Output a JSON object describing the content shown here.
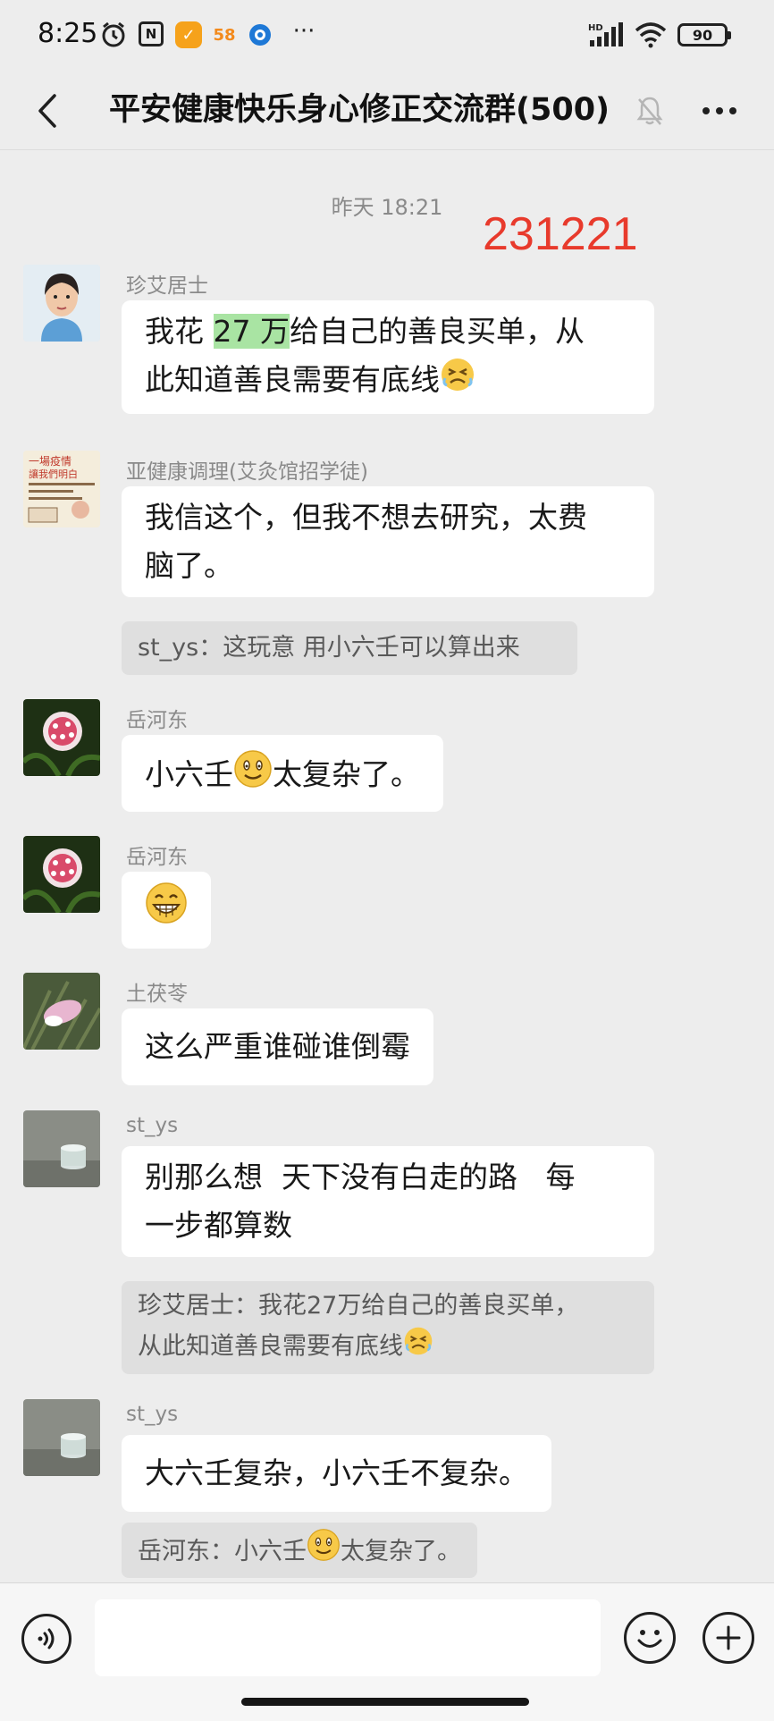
{
  "status_bar": {
    "time": "8:25",
    "app_icon_58": "58",
    "more": "···",
    "network": "HD",
    "battery": "90"
  },
  "header": {
    "title": "平安健康快乐身心修正交流群(500)",
    "muted": true
  },
  "chat": {
    "timestamp": "昨天 18:21",
    "overlay_code": "231221",
    "messages": [
      {
        "sender": "珍艾居士",
        "parts": [
          "我花 ",
          "27 万",
          "给自己的善良买单，从",
          "此知道善良需要有底线"
        ],
        "emoji": "persevering-face"
      },
      {
        "sender": "亚健康调理(艾灸馆招学徒)",
        "lines": [
          "我信这个，但我不想去研究，太费",
          "脑了。"
        ],
        "quote": "st_ys：这玩意 用小六壬可以算出来"
      },
      {
        "sender": "岳河东",
        "text_before": "小六壬",
        "text_after": "太复杂了。",
        "emoji": "smiling-face"
      },
      {
        "sender": "岳河东",
        "emoji": "grinning-face"
      },
      {
        "sender": "土茯苓",
        "text": "这么严重谁碰谁倒霉"
      },
      {
        "sender": "st_ys",
        "lines": [
          "别那么想  天下没有白走的路   每",
          "一步都算数"
        ],
        "quote_lines": [
          "珍艾居士：我花27万给自己的善良买单，",
          "从此知道善良需要有底线"
        ]
      },
      {
        "sender": "st_ys",
        "text": "大六壬复杂，小六壬不复杂。",
        "quote_before": "岳河东：小六壬",
        "quote_after": "太复杂了。"
      }
    ]
  },
  "avatar_labels": {
    "poster_line1": "一場疫情",
    "poster_line2": "讓我們明白"
  },
  "colors": {
    "background": "#ededed",
    "bubble": "#ffffff",
    "highlight": "#a9e4a3",
    "overlay_red": "#e83a2c",
    "quote_bg": "#dfdfdf"
  }
}
